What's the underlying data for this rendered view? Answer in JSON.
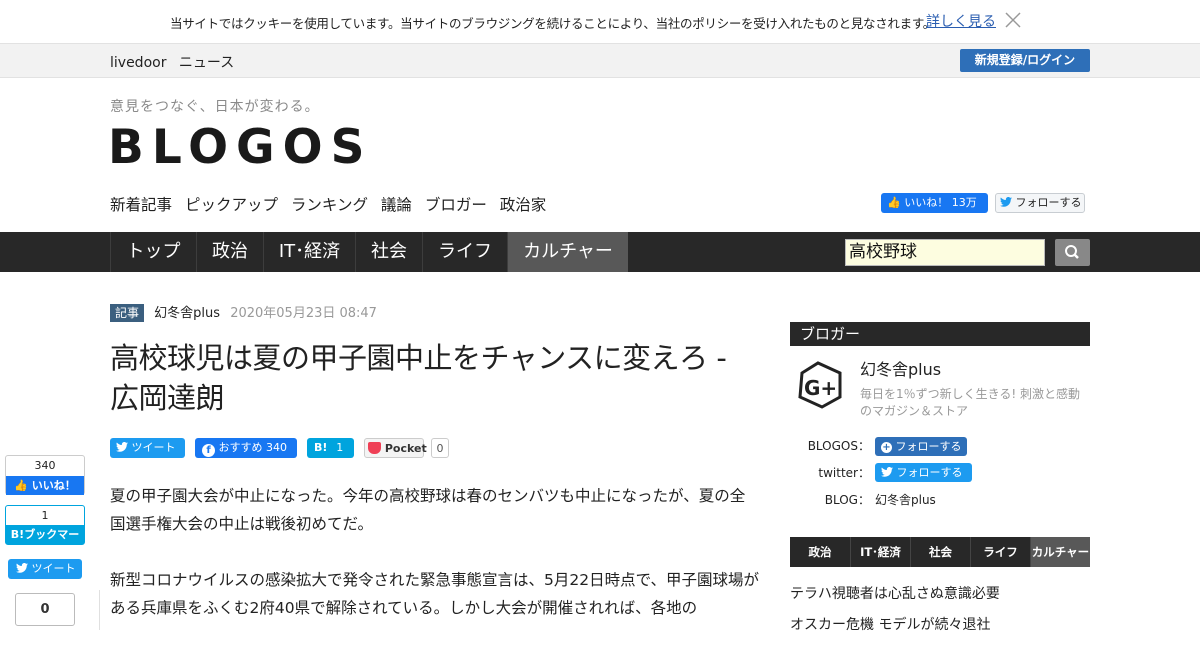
{
  "cookie": {
    "message": "当サイトではクッキーを使用しています。当サイトのブラウジングを続けることにより、当社のポリシーを受け入れたものと見なされます。",
    "more_link": "詳しく見る"
  },
  "topbar": {
    "brand_livedoor": "livedoor",
    "brand_news": "ニュース",
    "login_label": "新規登録/ログイン"
  },
  "header": {
    "tagline": "意見をつなぐ、日本が変わる。",
    "logo": "BLOGOS",
    "subnav": [
      "新着記事",
      "ピックアップ",
      "ランキング",
      "議論",
      "ブロガー",
      "政治家"
    ],
    "fb_like": "いいね！ 13万",
    "tw_follow": "フォローする"
  },
  "mainnav": {
    "items": [
      "トップ",
      "政治",
      "IT･経済",
      "社会",
      "ライフ",
      "カルチャー"
    ],
    "active": "カルチャー",
    "search_value": "高校野球"
  },
  "article": {
    "tag": "記事",
    "author": "幻冬舎plus",
    "date": "2020年05月23日 08:47",
    "title": "高校球児は夏の甲子園中止をチャンスに変えろ - 広岡達朗",
    "share": {
      "tweet": "ツイート",
      "fb_recommend": "おすすめ",
      "fb_count": "340",
      "hatena_label": "B!",
      "hatena_count": "1",
      "pocket_label": "Pocket",
      "pocket_count": "0"
    },
    "paragraphs": [
      "夏の甲子園大会が中止になった。今年の高校野球は春のセンバツも中止になったが、夏の全国選手権大会の中止は戦後初めてだ。",
      "新型コロナウイルスの感染拡大で発令された緊急事態宣言は、5月22日時点で、甲子園球場がある兵庫県をふくむ2府40県で解除されている。しかし大会が開催されれば、各地の"
    ]
  },
  "float_share": {
    "fb_count": "340",
    "fb_label": "いいね！",
    "hatena_count": "1",
    "hatena_label": "B!ブックマーク",
    "tweet_label": "ツイート",
    "pocket_count": "0"
  },
  "sidebar": {
    "heading": "ブロガー",
    "blogger_name": "幻冬舎plus",
    "blogger_desc": "毎日を1％ずつ新しく生きる! 刺激と感動のマガジン＆ストア",
    "blogos_label": "BLOGOS：",
    "blogos_follow": "フォローする",
    "twitter_label": "twitter：",
    "twitter_follow": "フォローする",
    "blog_label": "BLOG：",
    "blog_value": "幻冬舎plus",
    "categories": [
      "政治",
      "IT･経済",
      "社会",
      "ライフ",
      "カルチャー"
    ],
    "active_category": "カルチャー",
    "links": [
      "テラハ視聴者は心乱さぬ意識必要",
      "オスカー危機 モデルが続々退社"
    ]
  },
  "colors": {
    "nav_bg": "#282828",
    "nav_active": "#585858",
    "accent_blue": "#2e6fb8",
    "facebook": "#1877f2",
    "twitter": "#1d9bf0",
    "hatena": "#00a4de",
    "pocket": "#ef4056"
  }
}
